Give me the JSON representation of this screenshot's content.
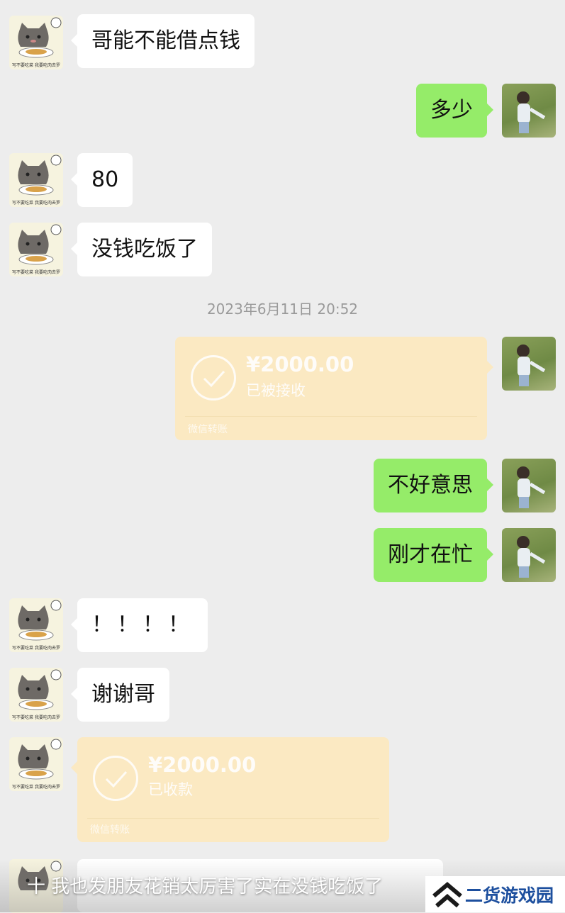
{
  "messages": [
    {
      "side": "left",
      "text": "哥能不能借点钱"
    },
    {
      "side": "right",
      "text": "多少"
    },
    {
      "side": "left",
      "text": "80"
    },
    {
      "side": "left",
      "text": "没钱吃饭了"
    },
    {
      "side": "right",
      "text": "不好意思"
    },
    {
      "side": "right",
      "text": "刚才在忙"
    },
    {
      "side": "left",
      "text": "！！！！"
    },
    {
      "side": "left",
      "text": "谢谢哥"
    }
  ],
  "timestamp": "2023年6月11日 20:52",
  "transfers": [
    {
      "side": "right",
      "amount": "¥2000.00",
      "status": "已被接收",
      "source": "微信转账"
    },
    {
      "side": "left",
      "amount": "¥2000.00",
      "status": "已收款",
      "source": "微信转账"
    }
  ],
  "avatars": {
    "friend_caption": "写不要吃菜 我要吃肉去罗"
  },
  "caption": "十 我也发朋友花销太厉害了实在没钱吃饭了",
  "watermark": {
    "text": "二货游戏园"
  },
  "colors": {
    "background": "#ededed",
    "bubble_self": "#95ec69",
    "bubble_other": "#ffffff",
    "transfer": "#fbe9c2",
    "watermark_blue": "#1d4f9e"
  }
}
